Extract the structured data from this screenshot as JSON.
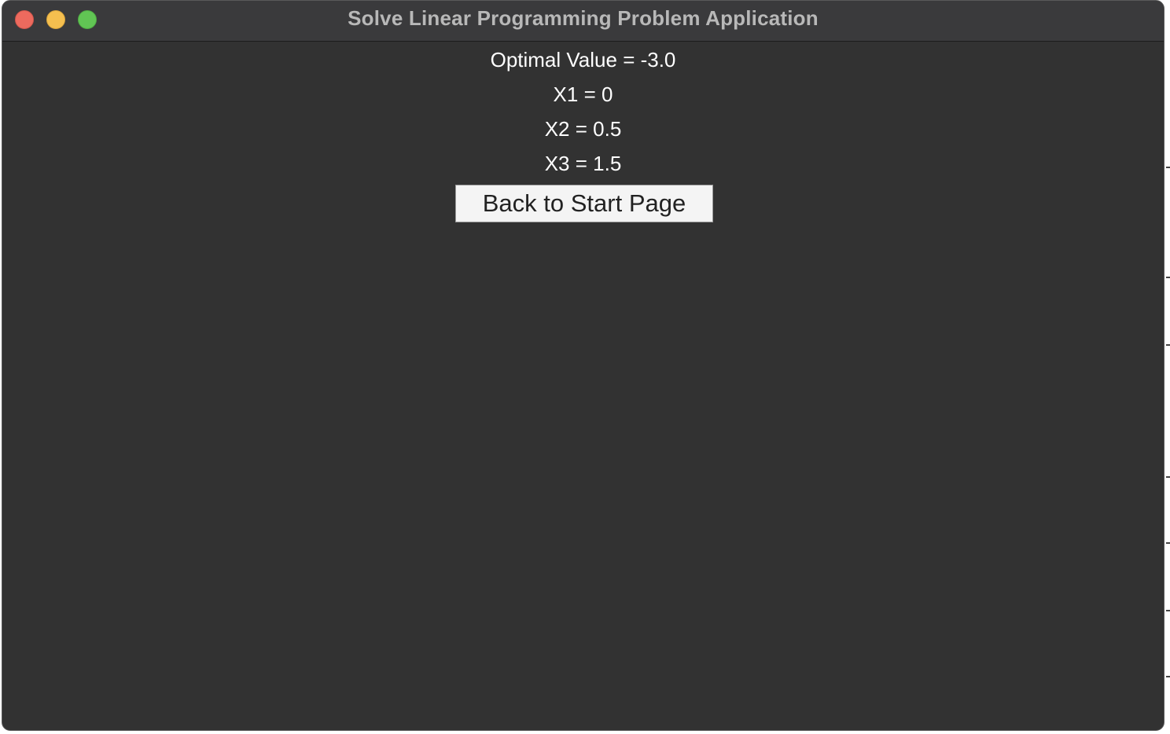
{
  "window": {
    "title": "Solve Linear Programming Problem Application"
  },
  "results": {
    "optimal_value": "Optimal Value = -3.0",
    "x1": "X1 = 0",
    "x2": "X2 = 0.5",
    "x3": "X3 = 1.5"
  },
  "actions": {
    "back_label": "Back to Start Page"
  },
  "colors": {
    "background": "#323232",
    "titlebar": "#3a3a3c",
    "text": "#ffffff",
    "button": "#f4f4f4",
    "close": "#ed6a5e",
    "minimize": "#f5bf4f",
    "maximize": "#61c554"
  }
}
